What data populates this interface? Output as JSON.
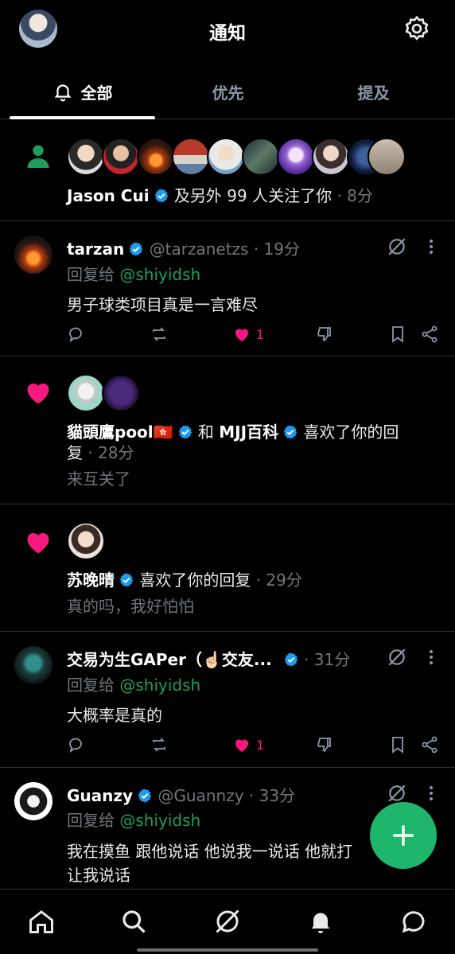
{
  "header": {
    "title": "通知"
  },
  "tabs": [
    {
      "label": "全部",
      "active": true
    },
    {
      "label": "优先",
      "active": false
    },
    {
      "label": "提及",
      "active": false
    }
  ],
  "follow": {
    "name": "Jason Cui",
    "text": "及另外 99 人关注了你",
    "time": "· 8分"
  },
  "reply1": {
    "name": "tarzan",
    "handle": "@tarzanetzs",
    "time": "· 19分",
    "reply_prefix": "回复给",
    "reply_to": "@shiyidsh",
    "text": "男子球类项目真是一言难尽",
    "likes": "1"
  },
  "like1": {
    "name1": "貓頭鷹pool🇭🇰",
    "joiner": "和",
    "name2": "MJJ百科",
    "text": "喜欢了你的回",
    "text2": "复",
    "time": "· 28分",
    "quote": "来互关了"
  },
  "like2": {
    "name": "苏晚晴",
    "text": "喜欢了你的回复",
    "time": "· 29分",
    "quote": "真的吗，我好怕怕"
  },
  "reply2": {
    "name": "交易为生GAPer（☝🏻交友...",
    "time": "· 31分",
    "reply_prefix": "回复给",
    "reply_to": "@shiyidsh",
    "text": "大概率是真的",
    "likes": "1"
  },
  "reply3": {
    "name": "Guanzy",
    "handle": "@Guannzy",
    "time": "· 33分",
    "reply_prefix": "回复给",
    "reply_to": "@shiyidsh",
    "text": "我在摸鱼 跟他说话 他说我一说话 他就打",
    "text2": "让我说话"
  },
  "colors": {
    "accent": "#1d9e5c",
    "like": "#f91880",
    "verified": "#1d9bf0",
    "fab": "#1db66b"
  }
}
